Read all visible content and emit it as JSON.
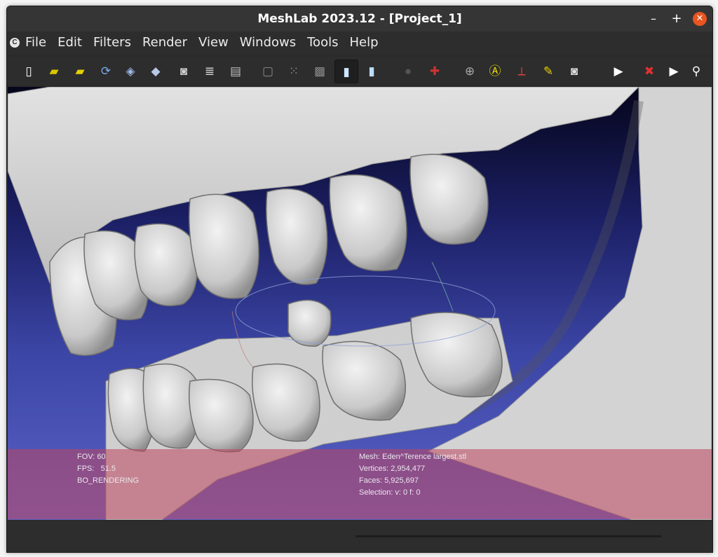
{
  "window": {
    "title": "MeshLab 2023.12 - [Project_1]",
    "controls": {
      "minimize": "–",
      "maximize": "+",
      "close": "✕"
    }
  },
  "menubar": {
    "items": [
      {
        "label": "File"
      },
      {
        "label": "Edit"
      },
      {
        "label": "Filters"
      },
      {
        "label": "Render"
      },
      {
        "label": "View"
      },
      {
        "label": "Windows"
      },
      {
        "label": "Tools"
      },
      {
        "label": "Help"
      }
    ]
  },
  "toolbar": {
    "buttons": [
      {
        "icon": "new-project-icon",
        "glyph": "▯",
        "color": "#ffffff"
      },
      {
        "icon": "open-project-icon",
        "glyph": "▰",
        "color": "#d8c600"
      },
      {
        "icon": "import-mesh-icon",
        "glyph": "▰",
        "color": "#e3d000"
      },
      {
        "icon": "reload-icon",
        "glyph": "⟳",
        "color": "#7aa6e8"
      },
      {
        "icon": "export-mesh-icon",
        "glyph": "◈",
        "color": "#9fb8e8"
      },
      {
        "icon": "layers-icon",
        "glyph": "◆",
        "color": "#b8c8e8"
      },
      {
        "icon": "snapshot-icon",
        "glyph": "◙",
        "color": "#cfcfcf"
      },
      {
        "icon": "raster-stack-icon",
        "glyph": "≣",
        "color": "#cfcfcf"
      },
      {
        "icon": "raster-icon",
        "glyph": "▤",
        "color": "#bdbdbd"
      },
      {
        "icon": "bounding-box-icon",
        "glyph": "▢",
        "color": "#8a8a8a"
      },
      {
        "icon": "points-icon",
        "glyph": "⁙",
        "color": "#8a8a8a"
      },
      {
        "icon": "wireframe-icon",
        "glyph": "▩",
        "color": "#8a8a8a"
      },
      {
        "icon": "flat-shading-icon",
        "glyph": "▮",
        "color": "#cfe6ff",
        "active": true
      },
      {
        "icon": "smooth-shading-icon",
        "glyph": "▮",
        "color": "#bcdcff"
      },
      {
        "icon": "trackball-icon",
        "glyph": "●",
        "color": "#555555"
      },
      {
        "icon": "axes-icon",
        "glyph": "✚",
        "color": "#cc3333"
      },
      {
        "icon": "grid-icon",
        "glyph": "⊕",
        "color": "#aaaaaa"
      },
      {
        "icon": "annotation-icon",
        "glyph": "Ⓐ",
        "color": "#f0e000"
      },
      {
        "icon": "measure-tool-icon",
        "glyph": "⟂",
        "color": "#e04040"
      },
      {
        "icon": "paint-tool-icon",
        "glyph": "✎",
        "color": "#e8d000"
      },
      {
        "icon": "camera-icon",
        "glyph": "◙",
        "color": "#dddddd"
      },
      {
        "icon": "play-icon",
        "glyph": "▶",
        "color": "#ffffff"
      },
      {
        "icon": "delete-icon",
        "glyph": "✖",
        "color": "#e03030"
      },
      {
        "icon": "next-icon",
        "glyph": "▶",
        "color": "#ffffff"
      },
      {
        "icon": "search-icon",
        "glyph": "⚲",
        "color": "#ffffff"
      }
    ]
  },
  "viewport_info": {
    "left": [
      "FOV: 60",
      "FPS:   51.5",
      "BO_RENDERING"
    ],
    "right": [
      "Mesh: Eden^Terence largest.stl",
      "Vertices: 2,954,477",
      "Faces: 5,925,697",
      "Selection: v: 0 f: 0"
    ]
  }
}
